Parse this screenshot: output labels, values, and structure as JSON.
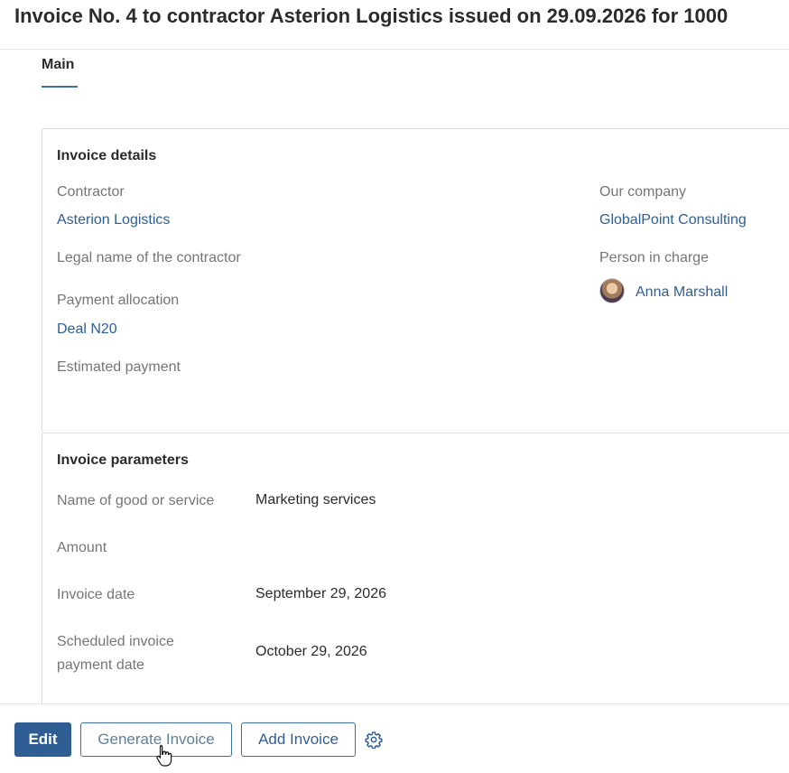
{
  "header": {
    "title": "Invoice No. 4 to contractor Asterion Logistics issued on 29.09.2026 for 1000"
  },
  "tabs": [
    {
      "label": "Main",
      "active": true
    }
  ],
  "invoice_details": {
    "section_title": "Invoice details",
    "contractor_label": "Contractor",
    "contractor_value": "Asterion Logistics",
    "legal_name_label": "Legal name of the contractor",
    "payment_allocation_label": "Payment allocation",
    "payment_allocation_value": "Deal N20",
    "estimated_payment_label": "Estimated payment",
    "our_company_label": "Our company",
    "our_company_value": "GlobalPoint Consulting",
    "person_label": "Person in charge",
    "person_value": "Anna Marshall"
  },
  "invoice_parameters": {
    "section_title": "Invoice parameters",
    "good_label": "Name of good or service",
    "good_value": "Marketing services",
    "amount_label": "Amount",
    "invoice_date_label": "Invoice date",
    "invoice_date_value": "September 29, 2026",
    "scheduled_label_line1": "Scheduled invoice",
    "scheduled_label_line2": "payment date",
    "scheduled_value": "October 29, 2026"
  },
  "actions": {
    "edit_label": "Edit",
    "generate_label": "Generate Invoice",
    "add_label": "Add Invoice",
    "settings_icon": "gear-icon"
  },
  "colors": {
    "accent": "#2f5e95",
    "label": "#757575",
    "text": "#2b2b2b"
  }
}
